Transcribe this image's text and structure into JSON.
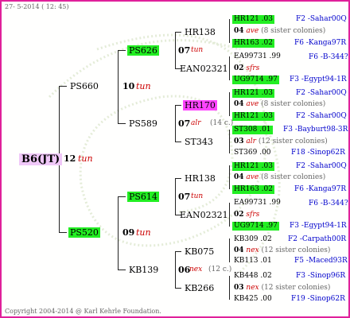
{
  "header": {
    "date": "27- 5-2014 ( 12: 45)"
  },
  "footer": {
    "copyright": "Copyright 2004-2014 @ Karl Kehrle Foundation."
  },
  "root": {
    "id": "B6(JT)",
    "gen": "12",
    "race": "tun"
  },
  "gen1": [
    {
      "id": "PS660",
      "gen": "10",
      "race": "tun"
    },
    {
      "id": "PS520",
      "gen": "09",
      "race": "tun"
    }
  ],
  "gen2": [
    {
      "id": "PS626"
    },
    {
      "id": "PS589",
      "gen": "07",
      "race": "alr",
      "count": "(14 c.)"
    },
    {
      "id": "PS614"
    },
    {
      "id": "KB139",
      "gen": "06",
      "race": "nex",
      "count": "(12 c.)"
    }
  ],
  "gen3": [
    {
      "id": "HR138",
      "gen": "07",
      "race": "tun"
    },
    {
      "id": "EAN02321"
    },
    {
      "id": "HR170"
    },
    {
      "id": "ST343"
    },
    {
      "id": "HR138",
      "gen": "07",
      "race": "tun"
    },
    {
      "id": "EAN02321"
    },
    {
      "id": "KB075"
    },
    {
      "id": "KB266"
    }
  ],
  "gen3_groups": [
    {
      "gen": "04",
      "race": "ave",
      "count": "(8 sister colonies)"
    },
    {
      "gen": "02",
      "race": "sfrs",
      "count": ""
    },
    {
      "gen": "04",
      "race": "ave",
      "count": "(8 sister colonies)"
    },
    {
      "gen": "03",
      "race": "alr",
      "count": "(12 sister colonies)"
    },
    {
      "gen": "04",
      "race": "ave",
      "count": "(8 sister colonies)"
    },
    {
      "gen": "02",
      "race": "sfrs",
      "count": ""
    },
    {
      "gen": "04",
      "race": "nex",
      "count": "(12 sister colonies)"
    },
    {
      "gen": "03",
      "race": "nex",
      "count": "(12 sister colonies)"
    }
  ],
  "leaves": [
    {
      "id": "HR121 .03",
      "origin": "F2 -Sahar00Q"
    },
    {
      "id": "HR163 .02",
      "origin": "F6 -Kanga97R"
    },
    {
      "id": "EA99731 .99",
      "origin": "F6 -B-344?"
    },
    {
      "id": "UG9714 .97",
      "origin": "F3 -Egypt94-1R"
    },
    {
      "id": "HR121 .03",
      "origin": "F2 -Sahar00Q"
    },
    {
      "id": "HR121 .03",
      "origin": "F2 -Sahar00Q"
    },
    {
      "id": "ST308 .01",
      "origin": "F3 -Bayburt98-3R"
    },
    {
      "id": "ST369 .00",
      "origin": "F18 -Sinop62R"
    },
    {
      "id": "HR121 .03",
      "origin": "F2 -Sahar00Q"
    },
    {
      "id": "HR163 .02",
      "origin": "F6 -Kanga97R"
    },
    {
      "id": "EA99731 .99",
      "origin": "F6 -B-344?"
    },
    {
      "id": "UG9714 .97",
      "origin": "F3 -Egypt94-1R"
    },
    {
      "id": "KB309 .02",
      "origin": "F2 -Carpath00R"
    },
    {
      "id": "KB113 .01",
      "origin": "F5 -Maced93R"
    },
    {
      "id": "KB448 .02",
      "origin": "F3 -Sinop96R"
    },
    {
      "id": "KB425 .00",
      "origin": "F19 -Sinop62R"
    }
  ]
}
